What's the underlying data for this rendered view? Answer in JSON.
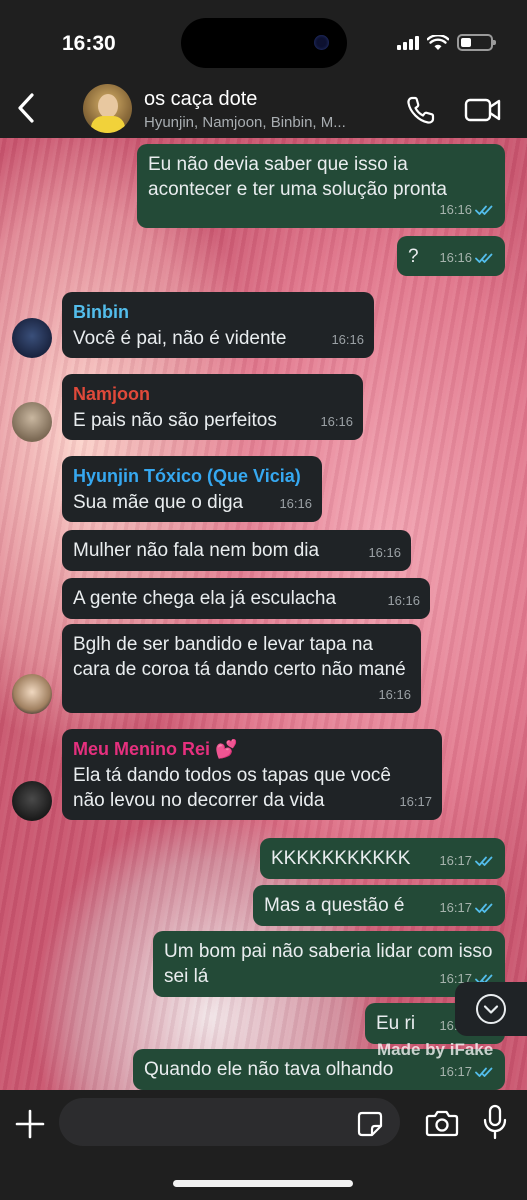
{
  "status_bar": {
    "time": "16:30"
  },
  "header": {
    "title": "os caça dote",
    "members": "Hyunjin, Namjoon, Binbin, M..."
  },
  "messages": [
    {
      "type": "out",
      "text": "Eu não devia saber que isso ia acontecer e ter uma solução pronta",
      "time": "16:16"
    },
    {
      "type": "out",
      "text": "?",
      "time": "16:16"
    },
    {
      "type": "in",
      "sender": "Binbin",
      "sender_color": "#53bdeb",
      "text": "Você é pai, não é vidente",
      "time": "16:16"
    },
    {
      "type": "in",
      "sender": "Namjoon",
      "sender_color": "#e0493a",
      "text": "E pais não são perfeitos",
      "time": "16:16"
    },
    {
      "type": "in",
      "sender": "Hyunjin Tóxico (Que Vicia)",
      "sender_color": "#36a8f0",
      "text": "Sua mãe que o diga",
      "time": "16:16"
    },
    {
      "type": "in",
      "text": "Mulher não fala nem bom dia",
      "time": "16:16"
    },
    {
      "type": "in",
      "text": "A gente chega ela já esculacha",
      "time": "16:16"
    },
    {
      "type": "in",
      "text": "Bglh de ser bandido e levar tapa na cara de coroa tá dando certo não mané",
      "time": "16:16"
    },
    {
      "type": "in",
      "sender": "Meu Menino Rei 💕",
      "sender_color": "#e5307e",
      "text": "Ela tá dando todos os tapas que você não levou no decorrer da vida",
      "time": "16:17"
    },
    {
      "type": "out",
      "text": "KKKKKKKKKKK",
      "time": "16:17"
    },
    {
      "type": "out",
      "text": "Mas a questão é",
      "time": "16:17"
    },
    {
      "type": "out",
      "text": "Um bom pai não saberia lidar com isso sei lá",
      "time": "16:17"
    },
    {
      "type": "out",
      "text": "Eu ri",
      "time": "16:17"
    },
    {
      "type": "out",
      "text": "Quando ele não tava olhando",
      "time": "16:17"
    }
  ],
  "watermark": "Made by iFake",
  "input": {
    "placeholder": ""
  },
  "colors": {
    "outgoing_bubble": "#234a37",
    "incoming_bubble": "#1f2326",
    "read_ticks": "#53bdeb"
  },
  "icons": [
    "back-chevron-icon",
    "phone-icon",
    "video-camera-icon",
    "chevron-down-icon",
    "plus-icon",
    "sticker-icon",
    "camera-icon",
    "microphone-icon"
  ]
}
